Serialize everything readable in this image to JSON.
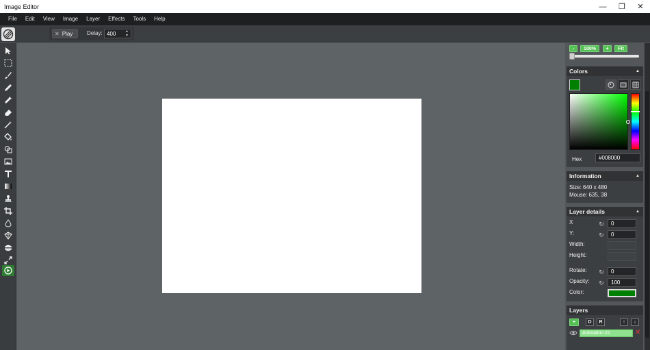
{
  "window": {
    "title": "Image Editor",
    "controls": [
      "—",
      "❐",
      "✕"
    ]
  },
  "menu": [
    "File",
    "Edit",
    "View",
    "Image",
    "Layer",
    "Effects",
    "Tools",
    "Help"
  ],
  "toolbar": {
    "play_label": "Play",
    "delay_label": "Delay:",
    "delay_value": "400"
  },
  "tools": [
    "select",
    "rectangle-select",
    "brush",
    "pencil",
    "pipette",
    "eraser",
    "magic-wand",
    "fill",
    "shape",
    "image",
    "text",
    "gradient",
    "clone-stamp",
    "crop",
    "blur",
    "sharpen",
    "bulge",
    "resize",
    "animation"
  ],
  "zoom": {
    "minus": "-",
    "value": "100%",
    "plus": "+",
    "fit": "Fit"
  },
  "colors": {
    "title": "Colors",
    "current": "#008000",
    "hex_label": "Hex",
    "hex_value": "#008000"
  },
  "information": {
    "title": "Information",
    "size": "Size: 640 x 480",
    "mouse": "Mouse: 635, 38"
  },
  "layer_details": {
    "title": "Layer details",
    "x_label": "X",
    "x_value": "0",
    "y_label": "Y:",
    "y_value": "0",
    "width_label": "Width:",
    "height_label": "Height:",
    "rotate_label": "Rotate:",
    "rotate_value": "0",
    "opacity_label": "Opacity:",
    "opacity_value": "100",
    "color_label": "Color:",
    "color_value": "#008000"
  },
  "layers": {
    "title": "Layers",
    "add": "+",
    "duplicate": "D",
    "rename": "R",
    "up": "↑",
    "down": "↓",
    "items": [
      {
        "name": "Animation #1"
      }
    ]
  }
}
